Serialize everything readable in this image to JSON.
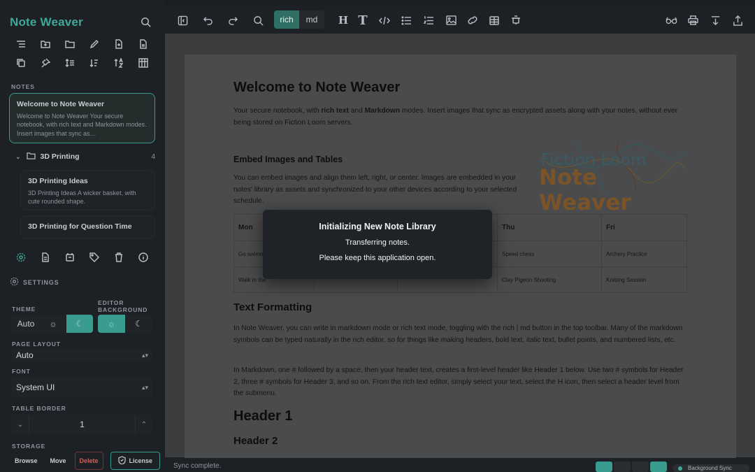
{
  "app": {
    "name": "Note Weaver"
  },
  "sidebar": {
    "notes_label": "NOTES",
    "notes": [
      {
        "title": "Welcome to Note Weaver",
        "snippet": "Welcome to Note Weaver Your secure notebook, with rich text and Markdown modes. Insert images that sync as…"
      },
      {
        "title": "3D Printing Ideas",
        "snippet": "3D Printing Ideas A wicker basket, with cute rounded shape."
      },
      {
        "title": "3D Printing for Question Time",
        "snippet": ""
      }
    ],
    "folder": {
      "name": "3D Printing",
      "count": "4"
    }
  },
  "settings": {
    "label": "SETTINGS",
    "theme_label": "THEME",
    "theme_value": "Auto",
    "editor_bg_label": "EDITOR BACKGROUND",
    "page_layout_label": "PAGE LAYOUT",
    "page_layout_value": "Auto",
    "font_label": "FONT",
    "font_value": "System UI",
    "table_border_label": "TABLE BORDER",
    "table_border_value": "1",
    "storage_label": "STORAGE",
    "storage_buttons": {
      "browse": "Browse",
      "move": "Move",
      "delete": "Delete",
      "license": "License"
    }
  },
  "toolbar": {
    "mode_rich": "rich",
    "mode_md": "md",
    "active_mode": "rich"
  },
  "document": {
    "title": "Welcome to Note Weaver",
    "intro_pre": "Your secure notebook, with ",
    "intro_b1": "rich text",
    "intro_mid": " and ",
    "intro_b2": "Markdown",
    "intro_post": " modes. Insert images that sync as encrypted assets along with your notes, without ever being stored on Fiction Loom servers.",
    "h_embed": "Embed Images and Tables",
    "p_embed": "You can embed images and align them left, right, or center. Images are embedded in your notes' library as assets and synchronized to your other devices according to your selected schedule.",
    "logo_line1": "Fiction Loom",
    "logo_line2": "Note Weaver",
    "table": {
      "headers": [
        "Mon",
        "",
        "",
        "Thu",
        "Fri"
      ],
      "rows": [
        [
          "Go swimming",
          "",
          "",
          "Speed chess",
          "Archery Practice"
        ],
        [
          "Walk in the",
          "",
          "",
          "Clay Pigeon Shooting",
          "Knitting Session"
        ]
      ]
    },
    "h_format": "Text Formatting",
    "p_format1": "In Note Weaver, you can write in markdown mode or rich text mode, toggling with the rich | md button in the top toolbar. Many of the markdown symbols can be typed naturally in the rich editor, so for things like making headers, bold text, italic text, bullet points, and numbered lists, etc.",
    "p_format2": "In Markdown, one # followed by a space, then your header text, creates a first-level header like Header 1 below. Use two # symbols for Header 2, three # symbols for Header 3, and so on. From the rich text editor, simply select your text, select the H icon, then select a header level from the submenu.",
    "header1": "Header 1",
    "header2": "Header 2"
  },
  "status": {
    "text": "Sync complete.",
    "background_sync": "Background Sync"
  },
  "modal": {
    "title": "Initializing New Note Library",
    "line1": "Transferring notes.",
    "line2": "Please keep this application open."
  },
  "colors": {
    "accent": "#3a9b8f",
    "brand": "#3fa898",
    "sidebar": "#1d2024",
    "danger": "#d0605a"
  }
}
